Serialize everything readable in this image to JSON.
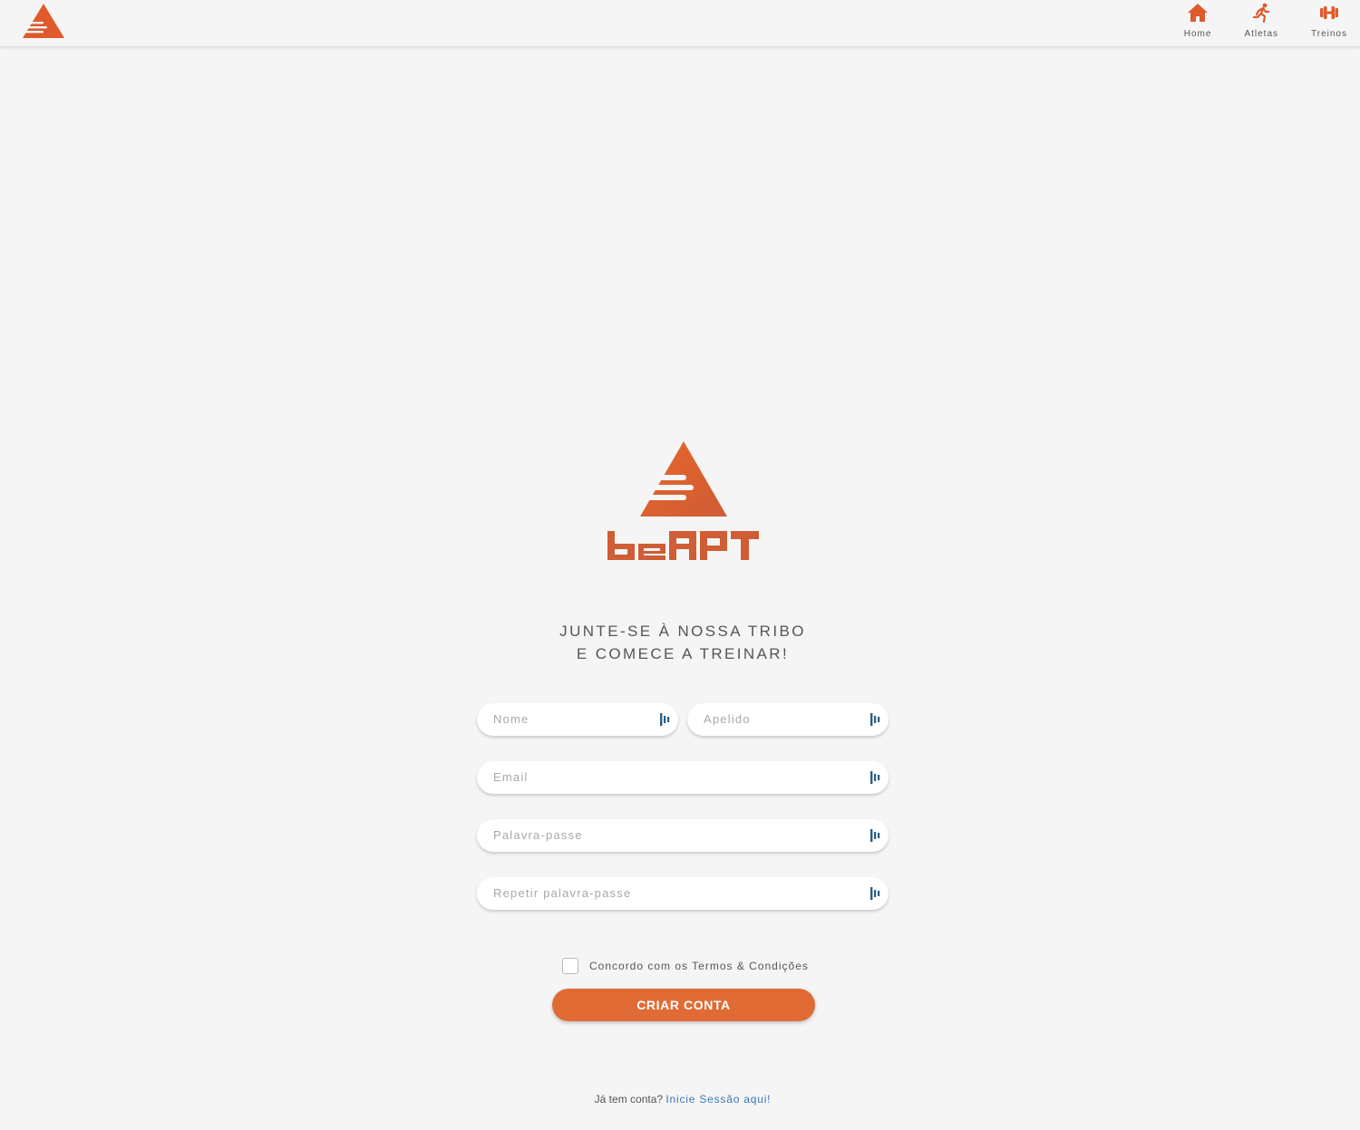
{
  "nav": {
    "items": [
      {
        "label": "Home",
        "icon": "home-icon"
      },
      {
        "label": "Atletas",
        "icon": "runner-icon"
      },
      {
        "label": "Treinos",
        "icon": "dumbbell-icon"
      }
    ]
  },
  "brand": {
    "logo_text": "beAPT",
    "color": "#e05a2b",
    "logo_gradient": [
      "#e8652a",
      "#cf5d35"
    ]
  },
  "signup": {
    "tagline_line1": "JUNTE-SE À NOSSA TRIBO",
    "tagline_line2": "E COMECE A TREINAR!",
    "fields": {
      "nome": {
        "placeholder": "Nome",
        "value": ""
      },
      "apelido": {
        "placeholder": "Apelido",
        "value": ""
      },
      "email": {
        "placeholder": "Email",
        "value": ""
      },
      "password": {
        "placeholder": "Palavra-passe",
        "value": ""
      },
      "password_repeat": {
        "placeholder": "Repetir palavra-passe",
        "value": ""
      }
    },
    "terms_label": "Concordo com os Termos & Condições",
    "terms_checked": false,
    "submit_label": "CRIAR CONTA",
    "login_prompt": "Já tem conta?",
    "login_link": "Inicie Sessão aqui!"
  },
  "colors": {
    "accent": "#e06b35",
    "link": "#3b78b5",
    "background": "#f5f5f5"
  }
}
